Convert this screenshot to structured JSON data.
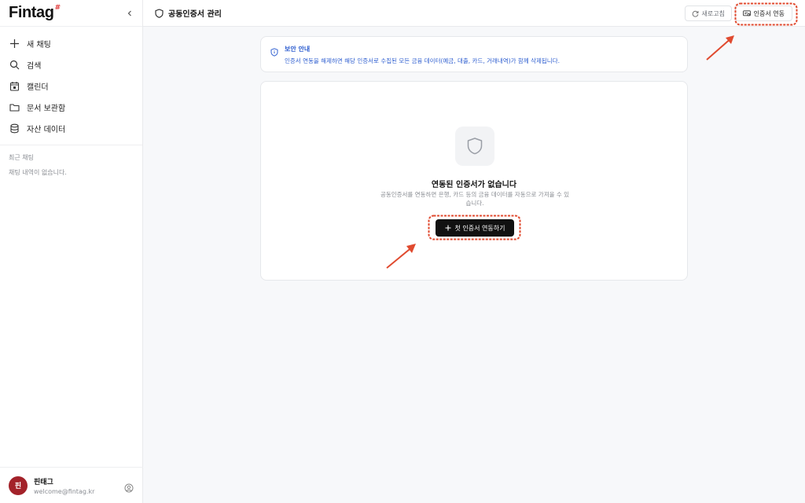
{
  "sidebar": {
    "brand": "Fintag",
    "brand_mark": "#",
    "collapse_icon": "chevron-left-icon",
    "nav": [
      {
        "label": "새 채팅",
        "icon": "plus-icon"
      },
      {
        "label": "검색",
        "icon": "search-icon"
      },
      {
        "label": "캘린더",
        "icon": "calendar-icon"
      },
      {
        "label": "문서 보관함",
        "icon": "folder-icon"
      },
      {
        "label": "자산 데이터",
        "icon": "database-icon"
      }
    ],
    "recent_title": "최근 채팅",
    "recent_empty": "채팅 내역이 없습니다.",
    "user": {
      "avatar": "핀",
      "name": "핀태그",
      "email": "welcome@fintag.kr",
      "settings_icon": "user-circle-icon",
      "avatar_color": "#a3222a"
    }
  },
  "header": {
    "title": "공동인증서 관리",
    "title_icon": "shield-icon",
    "refresh_label": "새로고침",
    "connect_label": "인증서 연동"
  },
  "notice": {
    "title": "보안 안내",
    "body": "인증서 연동을 해제하면 해당 인증서로 수집된 모든 금융 데이터(예금, 대출, 카드, 거래내역)가 함께 삭제됩니다.",
    "color": "#2f5fd0"
  },
  "empty_state": {
    "title": "연동된 인증서가 없습니다",
    "desc": "공동인증서를 연동하면 은행, 카드 등의 금융 데이터를 자동으로 가져올 수 있습니다.",
    "button": "첫 인증서 연동하기"
  },
  "colors": {
    "accent": "#111111",
    "annotation": "#e04a2f"
  }
}
